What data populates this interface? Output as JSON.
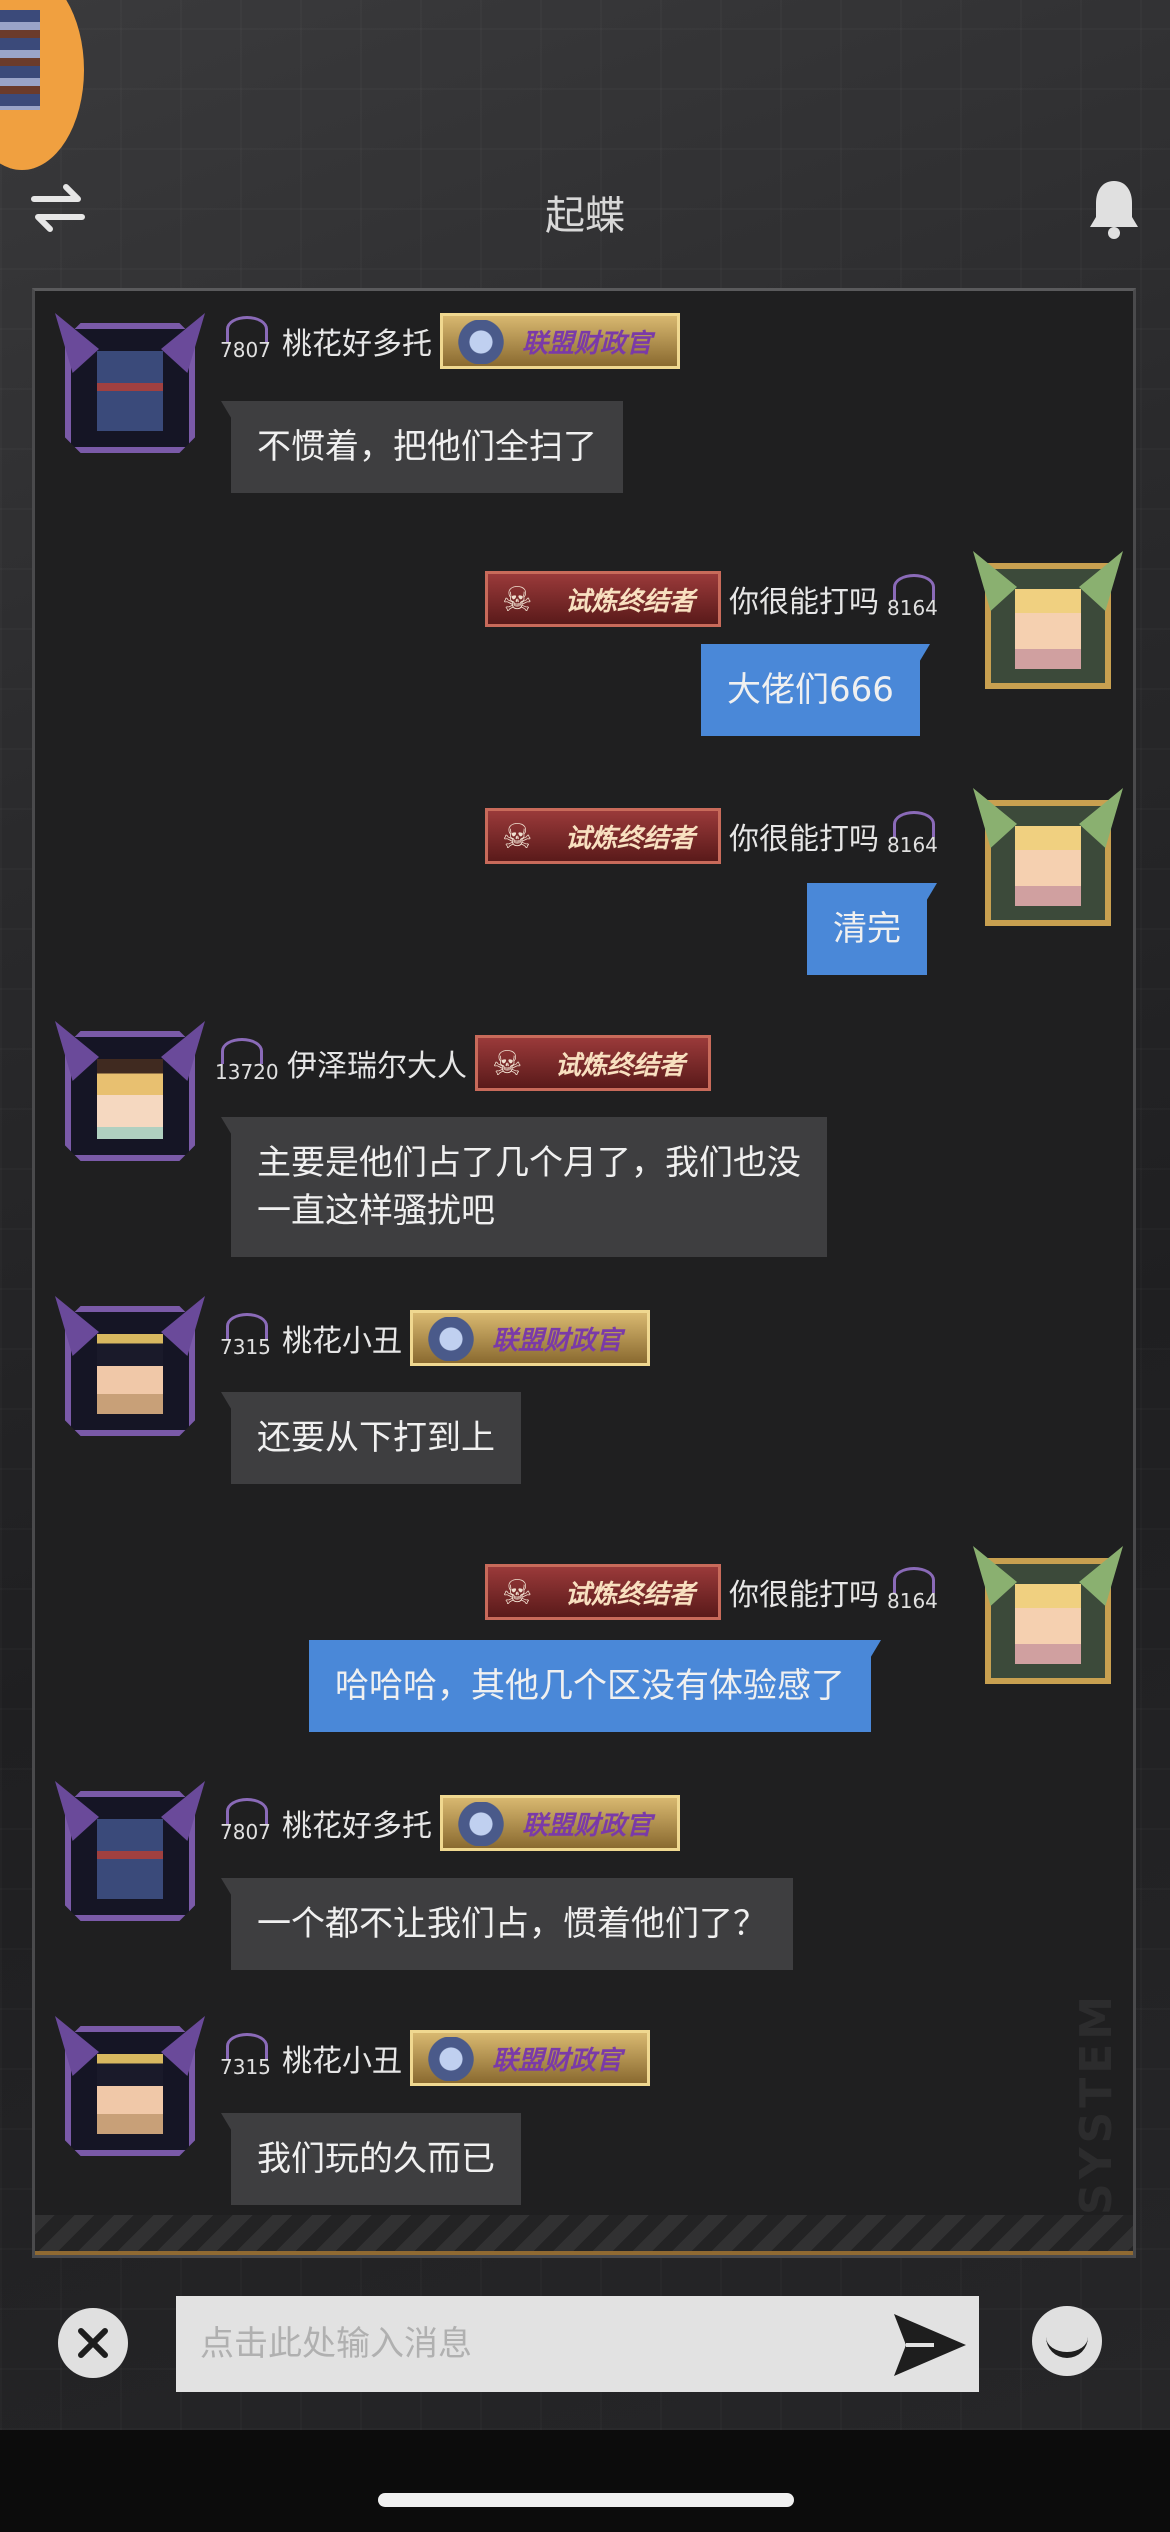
{
  "header": {
    "title": "起蝶"
  },
  "messages": [
    {
      "side": "left",
      "level": "7807",
      "name": "桃花好多托",
      "badge": "联盟财政官",
      "badge_style": "gold",
      "avatar": "dragon",
      "text": "不惯着，把他们全扫了"
    },
    {
      "side": "right",
      "level": "8164",
      "name": "你很能打吗",
      "badge": "试炼终结者",
      "badge_style": "red",
      "avatar": "blonde",
      "text": "大佬们666"
    },
    {
      "side": "right",
      "level": "8164",
      "name": "你很能打吗",
      "badge": "试炼终结者",
      "badge_style": "red",
      "avatar": "blonde",
      "text": "清完"
    },
    {
      "side": "left",
      "level": "13720",
      "name": "伊泽瑞尔大人",
      "badge": "试炼终结者",
      "badge_style": "red",
      "avatar": "girl",
      "text": "主要是他们占了几个月了，我们也没\n一直这样骚扰吧"
    },
    {
      "side": "left",
      "level": "7315",
      "name": "桃花小丑",
      "badge": "联盟财政官",
      "badge_style": "gold",
      "avatar": "darkhair",
      "text": "还要从下打到上"
    },
    {
      "side": "right",
      "level": "8164",
      "name": "你很能打吗",
      "badge": "试炼终结者",
      "badge_style": "red",
      "avatar": "blonde",
      "text": "哈哈哈，其他几个区没有体验感了"
    },
    {
      "side": "left",
      "level": "7807",
      "name": "桃花好多托",
      "badge": "联盟财政官",
      "badge_style": "gold",
      "avatar": "dragon",
      "text": "一个都不让我们占，惯着他们了？"
    },
    {
      "side": "left",
      "level": "7315",
      "name": "桃花小丑",
      "badge": "联盟财政官",
      "badge_style": "gold",
      "avatar": "darkhair",
      "text": "我们玩的久而已"
    }
  ],
  "watermark": "SYSTEM",
  "input": {
    "placeholder": "点击此处输入消息"
  },
  "icons": {
    "swap": "swap-arrows-icon",
    "bell": "bell-icon",
    "close": "close-icon",
    "send": "send-icon",
    "emoji": "emoji-icon"
  },
  "colors": {
    "bubble_self": "#4a88d8",
    "bubble_other": "#3e3e40",
    "panel": "#1f1f20"
  }
}
